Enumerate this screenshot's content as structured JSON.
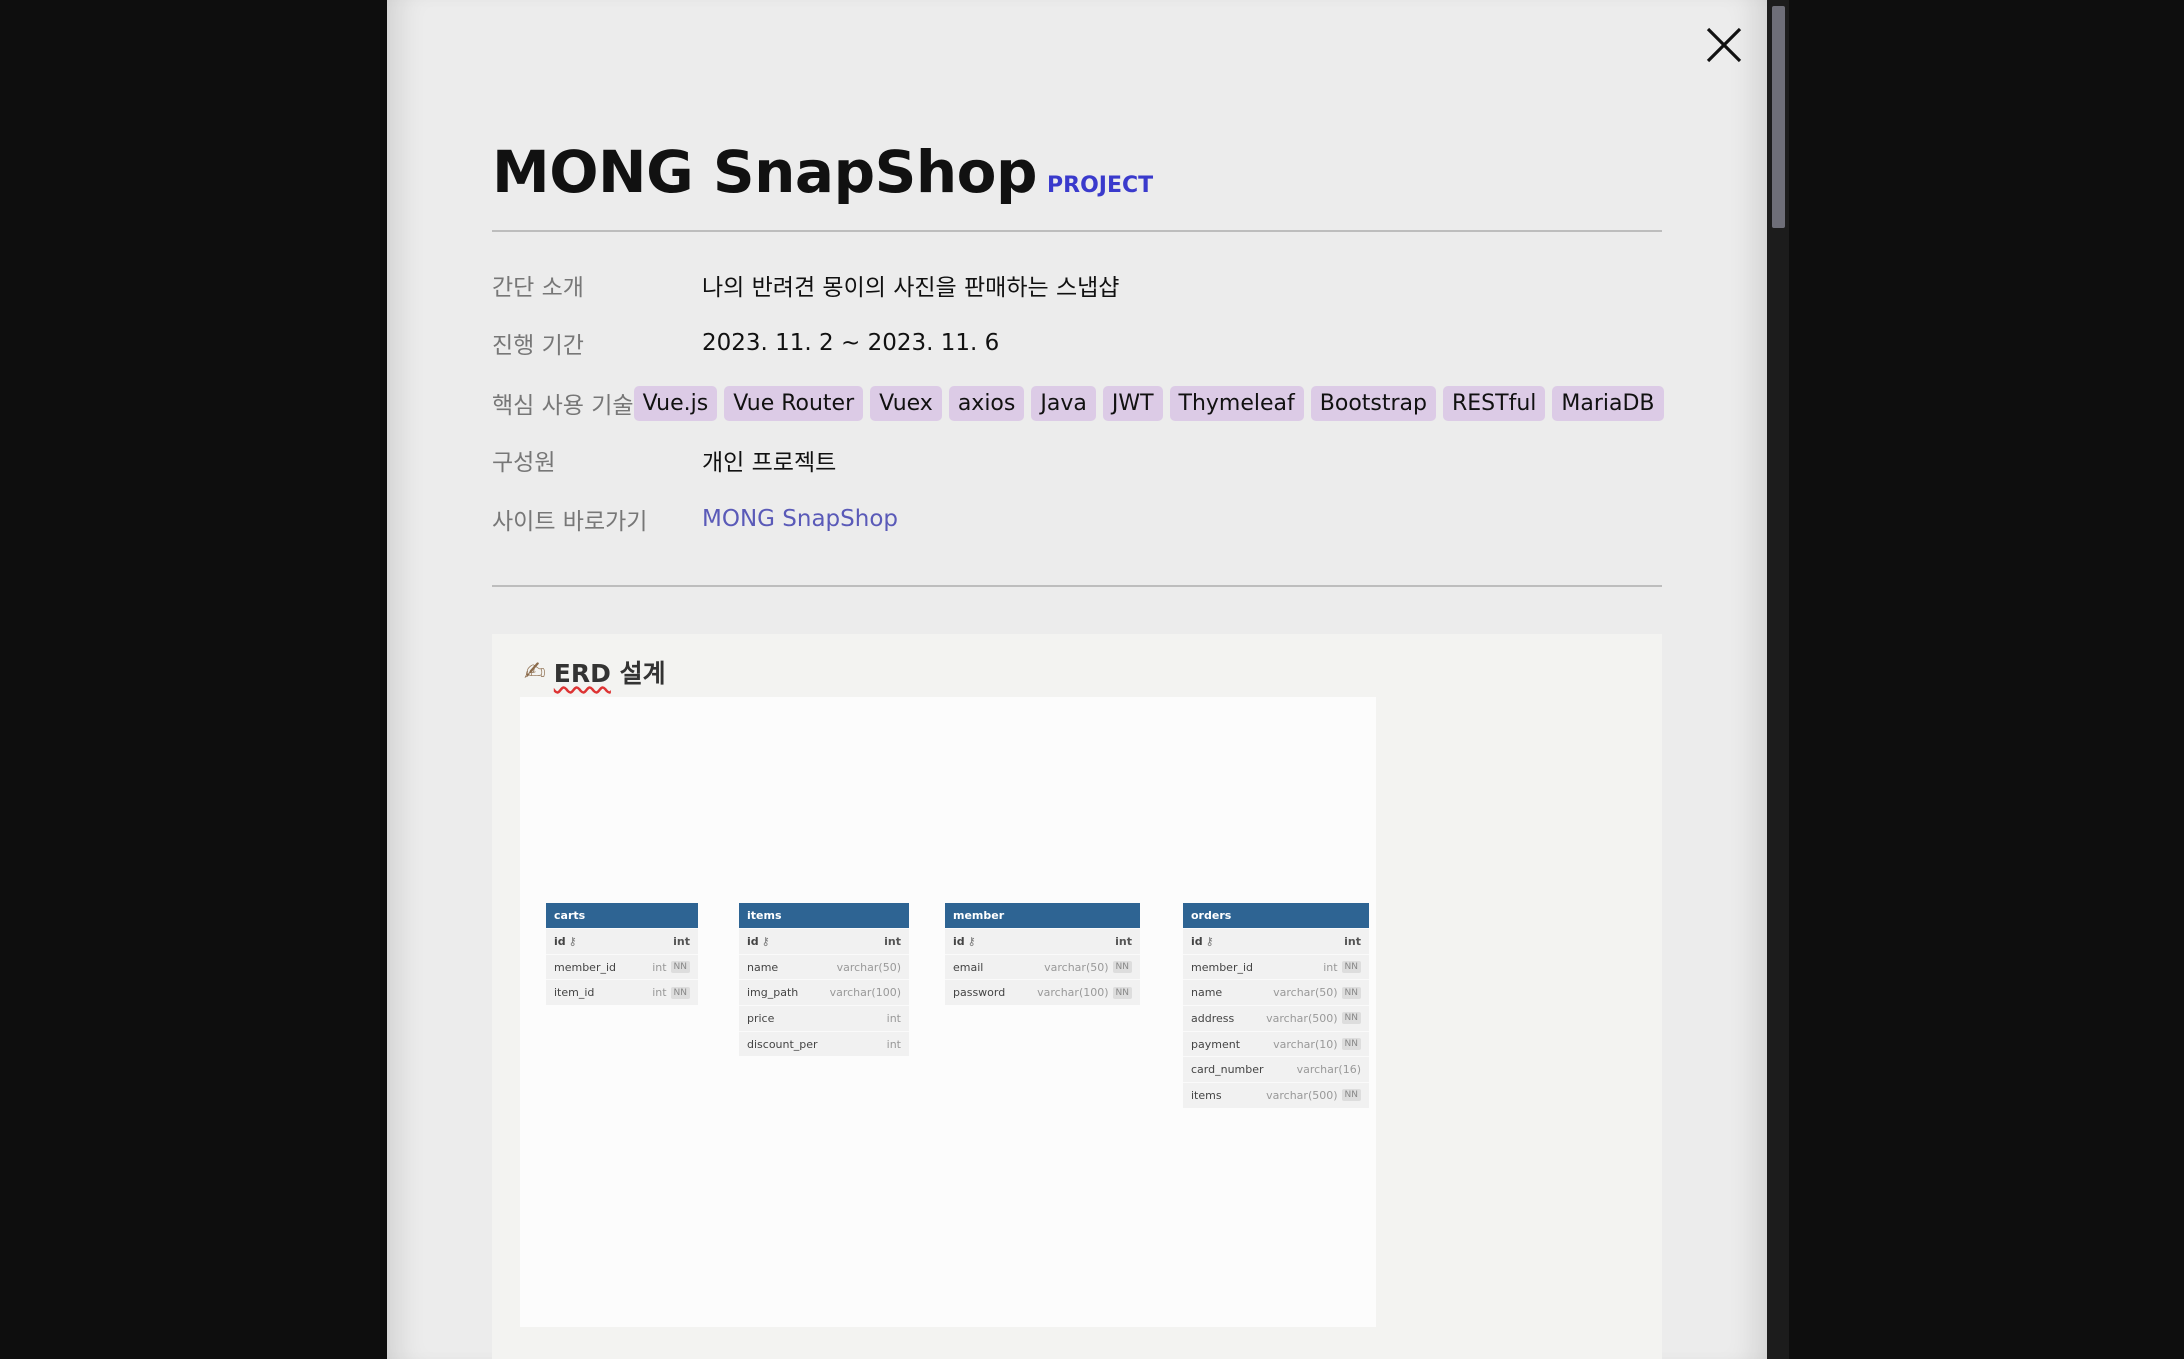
{
  "project": {
    "title": "MONG SnapShop",
    "tag": "PROJECT"
  },
  "info": [
    {
      "label": "간단 소개",
      "value": "나의 반려견 몽이의 사진을 판매하는 스냅샵"
    },
    {
      "label": "진행 기간",
      "value": "2023. 11. 2 ~ 2023. 11. 6"
    },
    {
      "label": "핵심 사용 기술",
      "tags": [
        "Vue.js",
        "Vue Router",
        "Vuex",
        "axios",
        "Java",
        "JWT",
        "Thymeleaf",
        "Bootstrap",
        "RESTful",
        "MariaDB"
      ]
    },
    {
      "label": "구성원",
      "value": "개인 프로젝트"
    },
    {
      "label": "사이트 바로가기",
      "link": "MONG SnapShop"
    }
  ],
  "erd": {
    "title_prefix": "ERD",
    "title_suffix": " 설계",
    "icon": "writing-hand-icon",
    "tables": [
      {
        "name": "carts",
        "columns": [
          {
            "name": "id",
            "type": "int",
            "pk": true,
            "nn": false
          },
          {
            "name": "member_id",
            "type": "int",
            "pk": false,
            "nn": true
          },
          {
            "name": "item_id",
            "type": "int",
            "pk": false,
            "nn": true
          }
        ]
      },
      {
        "name": "items",
        "columns": [
          {
            "name": "id",
            "type": "int",
            "pk": true,
            "nn": false
          },
          {
            "name": "name",
            "type": "varchar(50)",
            "pk": false,
            "nn": false
          },
          {
            "name": "img_path",
            "type": "varchar(100)",
            "pk": false,
            "nn": false
          },
          {
            "name": "price",
            "type": "int",
            "pk": false,
            "nn": false
          },
          {
            "name": "discount_per",
            "type": "int",
            "pk": false,
            "nn": false
          }
        ]
      },
      {
        "name": "member",
        "columns": [
          {
            "name": "id",
            "type": "int",
            "pk": true,
            "nn": false
          },
          {
            "name": "email",
            "type": "varchar(50)",
            "pk": false,
            "nn": true
          },
          {
            "name": "password",
            "type": "varchar(100)",
            "pk": false,
            "nn": true
          }
        ]
      },
      {
        "name": "orders",
        "columns": [
          {
            "name": "id",
            "type": "int",
            "pk": true,
            "nn": false
          },
          {
            "name": "member_id",
            "type": "int",
            "pk": false,
            "nn": true
          },
          {
            "name": "name",
            "type": "varchar(50)",
            "pk": false,
            "nn": true
          },
          {
            "name": "address",
            "type": "varchar(500)",
            "pk": false,
            "nn": true
          },
          {
            "name": "payment",
            "type": "varchar(10)",
            "pk": false,
            "nn": true
          },
          {
            "name": "card_number",
            "type": "varchar(16)",
            "pk": false,
            "nn": false
          },
          {
            "name": "items",
            "type": "varchar(500)",
            "pk": false,
            "nn": true
          }
        ]
      }
    ]
  },
  "nn_label": "NN",
  "colors": {
    "accent_tag": "#3a3acc",
    "tech_tag_bg": "#dccbe6",
    "link": "#5a5ab8",
    "erd_header": "#2e6493"
  }
}
